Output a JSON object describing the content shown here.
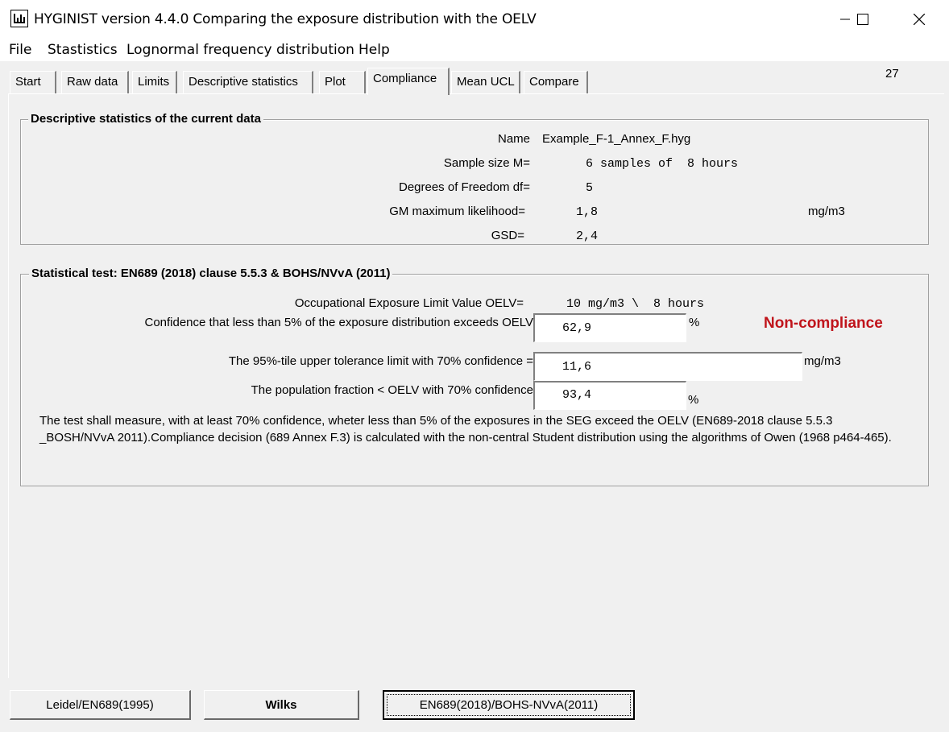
{
  "window": {
    "title": "HYGINIST version 4.4.0  Comparing the exposure distribution with the OELV"
  },
  "menu": [
    "File",
    "Stastistics",
    "Lognormal frequency distribution",
    "Help"
  ],
  "tabs": [
    "Start",
    "Raw data",
    "Limits",
    "Descriptive statistics",
    "Plot",
    "Compliance",
    "Mean UCL",
    "Compare"
  ],
  "active_tab": "Compliance",
  "corner_number": "27",
  "descriptive": {
    "heading": "Descriptive statistics of the current data",
    "name_label": "Name",
    "name_value": "Example_F-1_Annex_F.hyg",
    "sample_label": "Sample size M=",
    "sample_value": "6 samples of  8 hours",
    "df_label": "Degrees of Freedom df=",
    "df_value": "5",
    "gm_label": "GM maximum likelihood=",
    "gm_value": "1,8",
    "gm_unit": "mg/m3",
    "gsd_label": "GSD=",
    "gsd_value": "2,4"
  },
  "test": {
    "heading": "Statistical test: EN689 (2018) clause 5.5.3 &  BOHS/NVvA (2011)",
    "oelv_label": "Occupational Exposure Limit Value OELV=",
    "oelv_value": "10 mg/m3 \\  8 hours",
    "confidence_label": "Confidence that less than 5% of the exposure distribution exceeds OELV",
    "confidence_value": "62,9",
    "confidence_unit": "%",
    "verdict": "Non-compliance",
    "verdict_color": "#c0141b",
    "utl_label": "The 95%-tile upper tolerance limit with 70% confidence =",
    "utl_value": "11,6",
    "utl_unit": "mg/m3",
    "fraction_label": "The population fraction < OELV with 70% confidence",
    "fraction_value": "93,4",
    "fraction_unit": "%",
    "description": "The test shall measure, with at least 70% confidence, wheter less than 5% of the exposures in the SEG exceed the OELV (EN689-2018 clause 5.5.3 _BOSH/NVvA 2011).Compliance decision (689 Annex F.3) is calculated with the non-central Student distribution using the algorithms of Owen (1968 p464-465)."
  },
  "buttons": {
    "leidel": "Leidel/EN689(1995)",
    "wilks": "Wilks",
    "en689": "EN689(2018)/BOHS-NVvA(2011)"
  },
  "icons": [
    "app-chart-icon",
    "minimize-icon",
    "maximize-icon",
    "close-icon"
  ]
}
